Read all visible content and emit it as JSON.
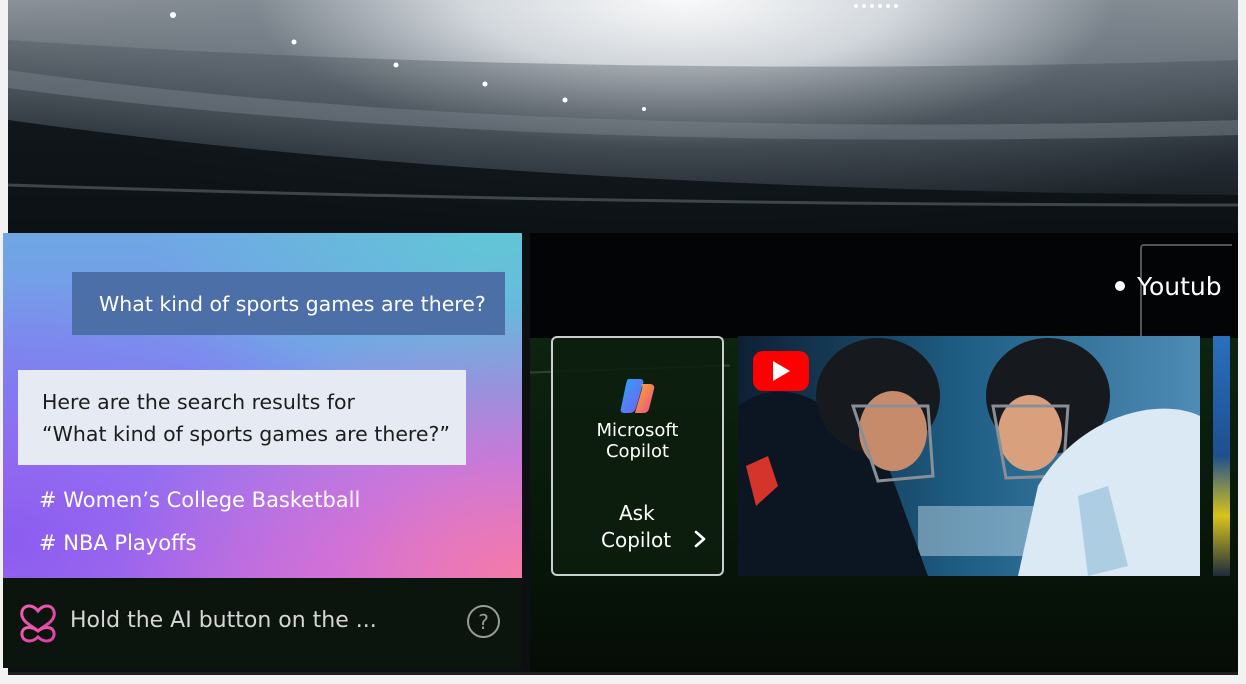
{
  "chat": {
    "user_query": "What kind of sports games are there?",
    "ai_response_line1": "Here are the search results for",
    "ai_response_line2": "“What kind of sports games are there?”",
    "suggestions": [
      "# Women’s College Basketball",
      "# NBA Playoffs"
    ]
  },
  "ai_bar": {
    "hint": "Hold the AI button on the ...",
    "help_glyph": "?",
    "logo_icon": "lg-ai-icon"
  },
  "content_row": {
    "section_label": "Youtub",
    "copilot_card": {
      "name_line1": "Microsoft",
      "name_line2": "Copilot",
      "action_line1": "Ask",
      "action_line2": "Copilot",
      "icon": "copilot-icon"
    },
    "video_icon": "youtube-icon"
  },
  "colors": {
    "user_bubble": "#4d6fa7",
    "ai_bubble": "#e6ebf3",
    "youtube_red": "#ff0000"
  }
}
